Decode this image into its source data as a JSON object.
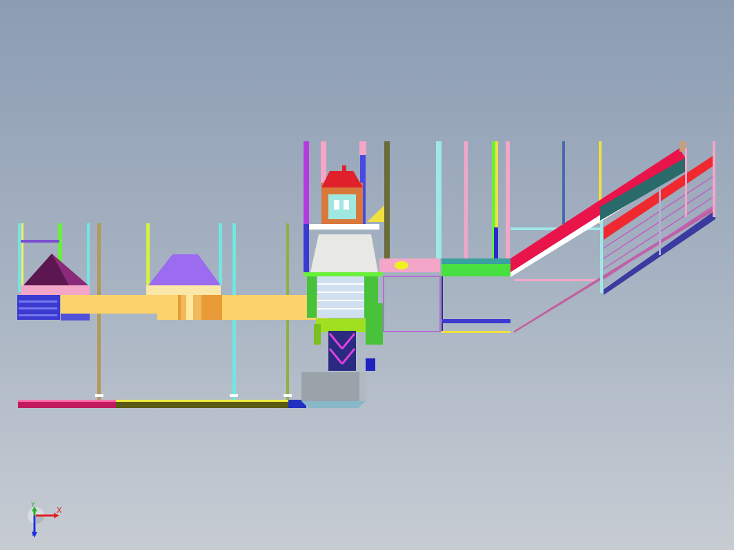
{
  "colors": {
    "bg_top": "#8c9db3",
    "bg_bottom": "#c7ccd3",
    "beam_yellow": "#fcd36a",
    "hopper_purple": "#5c1650",
    "hopper_violet": "#9b6cf0",
    "frame_green": "#48c23a",
    "conveyor_red": "#e8144a",
    "pink": "#f4a6c8",
    "cyan": "#6fe8e0",
    "blue": "#3a3ad0",
    "axis_x": "#e02020",
    "axis_y": "#20b020",
    "axis_z": "#2030e0"
  },
  "triad": {
    "x_label": "X",
    "y_label": "Y",
    "z_label": "Z"
  }
}
